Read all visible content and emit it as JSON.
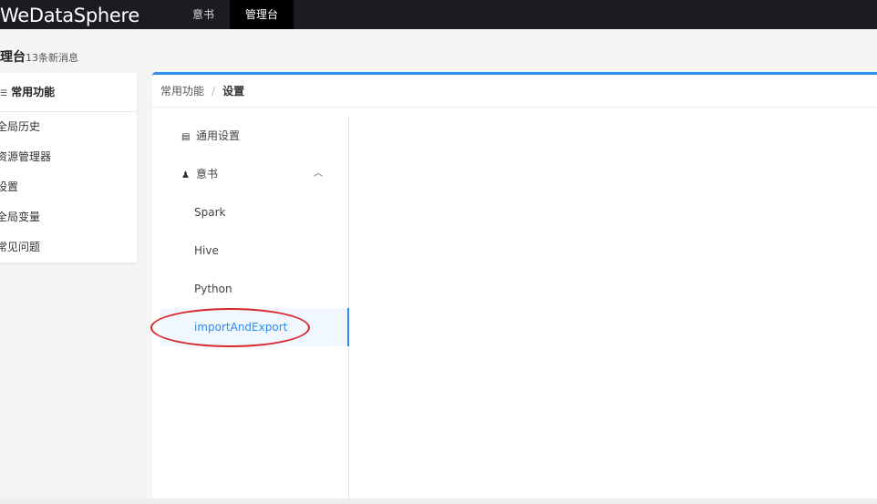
{
  "app": {
    "brand": "WeDataSphere"
  },
  "topnav": {
    "items": [
      {
        "label": "意书"
      },
      {
        "label": "管理台"
      }
    ]
  },
  "page_header": {
    "title": "理台",
    "subtitle": "13条新消息"
  },
  "left_card": {
    "head": "常用功能",
    "items": [
      {
        "label": "全局历史"
      },
      {
        "label": "资源管理器"
      },
      {
        "label": "设置"
      },
      {
        "label": "全局变量"
      },
      {
        "label": "常见问题"
      }
    ]
  },
  "breadcrumb": {
    "parent": "常用功能",
    "separator": "/",
    "current": "设置"
  },
  "settings_menu": {
    "general": "通用设置",
    "group": "意书",
    "group_expanded": true,
    "sub_items": [
      {
        "label": "Spark"
      },
      {
        "label": "Hive"
      },
      {
        "label": "Python"
      },
      {
        "label": "importAndExport"
      }
    ],
    "active_item": "importAndExport"
  },
  "colors": {
    "accent": "#2d8cf0",
    "topbar": "#1b1c21",
    "annotation": "#d9272e"
  }
}
